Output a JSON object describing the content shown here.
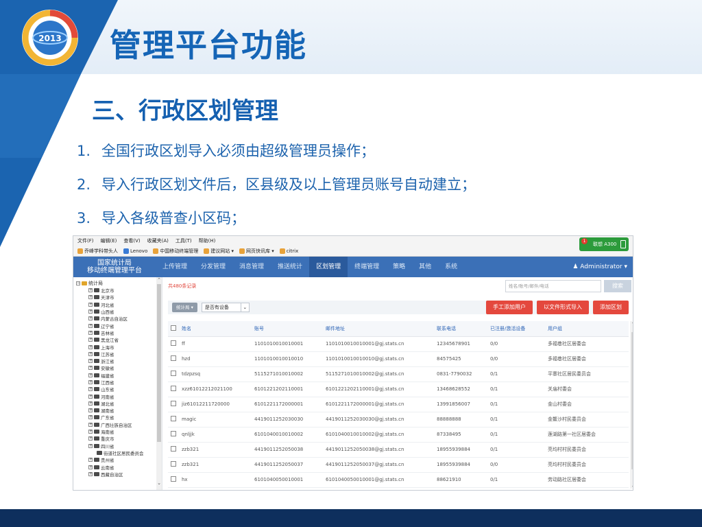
{
  "slide": {
    "title": "管理平台功能",
    "section": "三、行政区划管理",
    "points": [
      {
        "num": "1.",
        "text": "全国行政区划导入必须由超级管理员操作；"
      },
      {
        "num": "2.",
        "text": "导入行政区划文件后，区县级及以上管理员账号自动建立；"
      },
      {
        "num": "3.",
        "text": "导入各级普查小区码；"
      }
    ],
    "colors": {
      "title": "#1565b6",
      "accent_band": "#1b64b0",
      "footer": "#0e2f5d"
    },
    "logo_icon": "2013-logo-icon"
  },
  "browser": {
    "menu": [
      "文件(F)",
      "编辑(E)",
      "查看(V)",
      "收藏夹(A)",
      "工具(T)",
      "帮助(H)"
    ],
    "bookmarks": [
      "乔峰学科带头人",
      "Lenovo",
      "中国移动终端管理",
      "建议网站 ▾",
      "网页快讯库 ▾",
      "citrix"
    ],
    "lenovo_badge": {
      "count": "1",
      "label": "联想 A300"
    }
  },
  "app": {
    "brand_line1": "国家统计局",
    "brand_line2": "移动终端管理平台",
    "nav": [
      "上传管理",
      "分发管理",
      "消息管理",
      "推送统计",
      "区划管理",
      "终端管理",
      "策略",
      "其他",
      "系统"
    ],
    "nav_active": "区划管理",
    "admin": "Administrator",
    "tree": {
      "root": "统计局",
      "nodes": [
        "北京市",
        "天津市",
        "河北省",
        "山西省",
        "内蒙古自治区",
        "辽宁省",
        "吉林省",
        "黑龙江省",
        "上海市",
        "江苏省",
        "浙江省",
        "安徽省",
        "福建省",
        "江西省",
        "山东省",
        "河南省",
        "湖北省",
        "湖南省",
        "广东省",
        "广西壮族自治区",
        "海南省",
        "重庆市",
        "四川省"
      ],
      "sub_node": "街道社区居民委员会",
      "nodes_after": [
        "贵州省",
        "云南省",
        "西藏自治区"
      ]
    },
    "record_count": "共480条记录",
    "search_placeholder": "姓名/账号/邮件/电话",
    "search_button": "搜索",
    "filter_stats": "统计局 ▾",
    "filter_device": "是否有设备",
    "buttons": {
      "manual_add": "手工添加用户",
      "file_add": "以文件形式导入",
      "add_region": "添加区划"
    },
    "columns": [
      "姓名",
      "账号",
      "邮件地址",
      "联系电话",
      "已注册/激活设备",
      "用户组"
    ],
    "rows": [
      [
        "ff",
        "1101010010010001",
        "1101010010010001@gj.stats.cn",
        "12345678901",
        "0/0",
        "多福巷社区居委会"
      ],
      [
        "hzd",
        "1101010010010010",
        "1101010010010010@gj.stats.cn",
        "84575425",
        "0/0",
        "多福巷社区居委会"
      ],
      [
        "tdzpzsq",
        "5115271010010002",
        "5115271010010002@gj.stats.cn",
        "0831-7790032",
        "0/1",
        "平寨社区居民委员会"
      ],
      [
        "xzz61012212021100",
        "6101221202110001",
        "6101221202110001@gj.stats.cn",
        "13468628552",
        "0/1",
        "关庙村委会"
      ],
      [
        "jiz61012211720000",
        "6101221172000001",
        "6101221172000001@gj.stats.cn",
        "13991856007",
        "0/1",
        "金山村委会"
      ],
      [
        "magic",
        "4419011252030030",
        "4419011252030030@gj.stats.cn",
        "88888888",
        "0/1",
        "金鳌沙村民委员会"
      ],
      [
        "qnljjk",
        "6101040010010002",
        "6101040010010002@gj.stats.cn",
        "87338495",
        "0/1",
        "莲湖路第一社区居委会"
      ],
      [
        "zzb321",
        "4419011252050038",
        "4419011252050038@gj.stats.cn",
        "18955939884",
        "0/1",
        "亮均村村民委员会"
      ],
      [
        "zzb321",
        "4419011252050037",
        "4419011252050037@gj.stats.cn",
        "18955939884",
        "0/0",
        "亮均村村民委员会"
      ],
      [
        "hx",
        "6101040050010001",
        "6101040050010001@gj.stats.cn",
        "88621910",
        "0/1",
        "劳动路社区居委会"
      ]
    ]
  }
}
